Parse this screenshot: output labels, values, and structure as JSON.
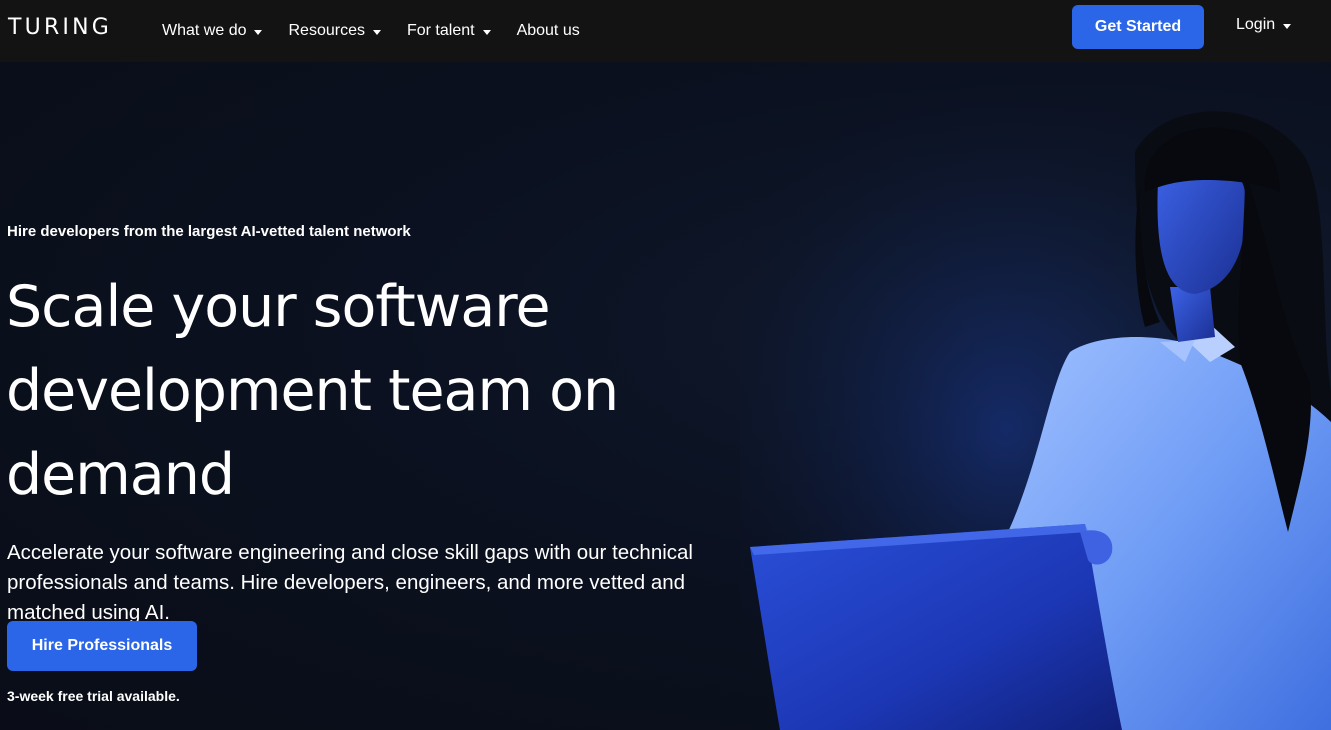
{
  "nav": {
    "logo": "TURING",
    "items": [
      {
        "label": "What we do",
        "dropdown": true
      },
      {
        "label": "Resources",
        "dropdown": true
      },
      {
        "label": "For talent",
        "dropdown": true
      },
      {
        "label": "About us",
        "dropdown": false
      }
    ],
    "cta_label": "Get Started",
    "login_label": "Login"
  },
  "hero": {
    "eyebrow": "Hire developers from the largest AI-vetted talent network",
    "headline_lines": [
      "Scale your software",
      "development team on",
      "demand"
    ],
    "subtext_lines": [
      "Accelerate your software engineering and close skill gaps with our technical",
      "professionals and teams. Hire developers, engineers, and more vetted and",
      "matched using AI."
    ],
    "cta_label": "Hire Professionals",
    "trial_note": "3-week free trial available."
  },
  "colors": {
    "accent": "#2b66e8",
    "nav_bg": "#131313",
    "hero_bg": "#0b1120"
  }
}
